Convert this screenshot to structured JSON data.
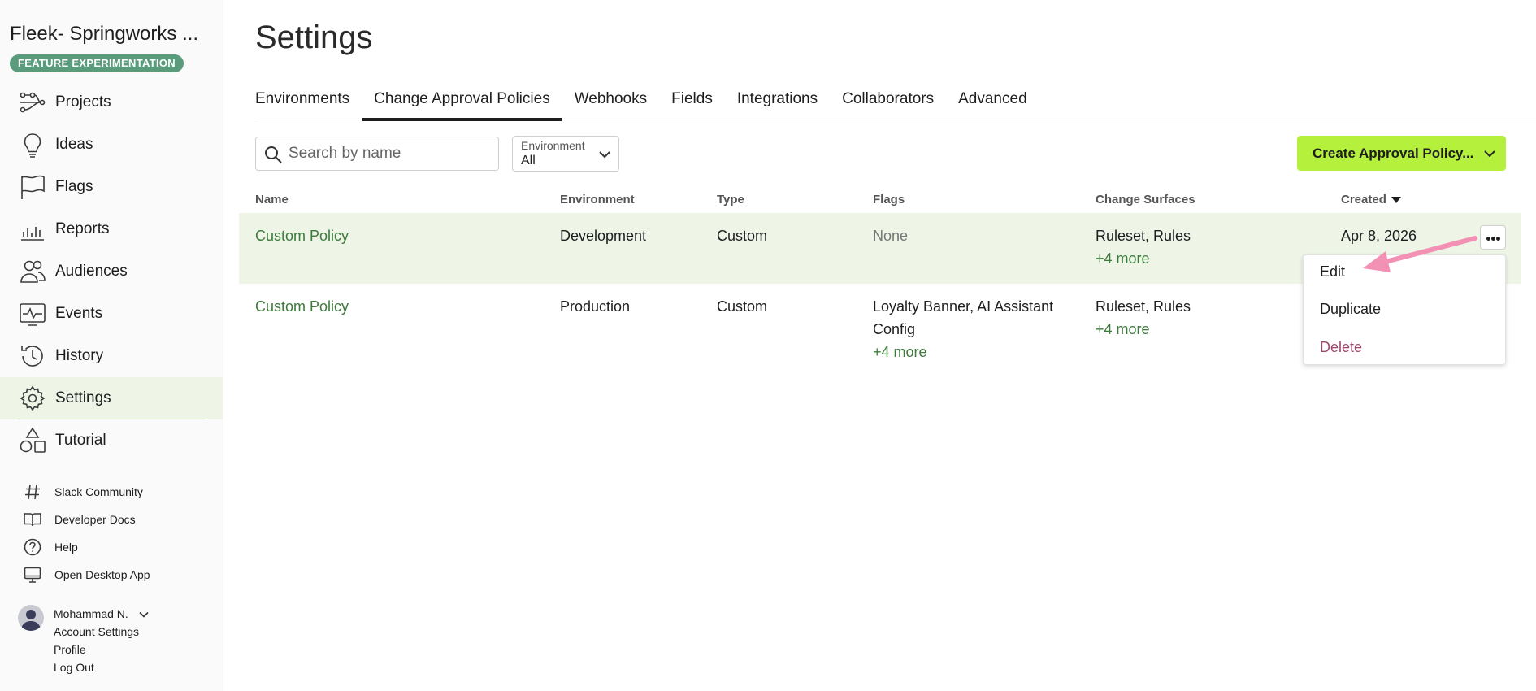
{
  "sidebar": {
    "org_name": "Fleek- Springworks ...",
    "badge": "FEATURE EXPERIMENTATION",
    "nav": [
      {
        "label": "Projects",
        "icon": "projects-icon"
      },
      {
        "label": "Ideas",
        "icon": "lightbulb-icon"
      },
      {
        "label": "Flags",
        "icon": "flag-icon"
      },
      {
        "label": "Reports",
        "icon": "chart-icon"
      },
      {
        "label": "Audiences",
        "icon": "people-icon"
      },
      {
        "label": "Events",
        "icon": "pulse-icon"
      },
      {
        "label": "History",
        "icon": "history-icon"
      },
      {
        "label": "Settings",
        "icon": "gear-icon",
        "active": true
      },
      {
        "label": "Tutorial",
        "icon": "shapes-icon"
      }
    ],
    "links": [
      {
        "label": "Slack Community",
        "icon": "hash-icon"
      },
      {
        "label": "Developer Docs",
        "icon": "book-icon"
      },
      {
        "label": "Help",
        "icon": "help-icon"
      },
      {
        "label": "Open Desktop App",
        "icon": "desktop-icon"
      }
    ],
    "user": {
      "name": "Mohammad N.",
      "account_settings": "Account Settings",
      "profile": "Profile",
      "logout": "Log Out"
    }
  },
  "main": {
    "title": "Settings",
    "tabs": [
      "Environments",
      "Change Approval Policies",
      "Webhooks",
      "Fields",
      "Integrations",
      "Collaborators",
      "Advanced"
    ],
    "active_tab": "Change Approval Policies",
    "search_placeholder": "Search by name",
    "env_filter": {
      "caption": "Environment",
      "value": "All"
    },
    "create_button": "Create Approval Policy...",
    "columns": [
      "Name",
      "Environment",
      "Type",
      "Flags",
      "Change Surfaces",
      "Created"
    ],
    "rows": [
      {
        "name": "Custom Policy",
        "environment": "Development",
        "type": "Custom",
        "flags_line1": "None",
        "flags_line2": "",
        "flags_more": "",
        "surfaces": "Ruleset, Rules",
        "surfaces_more": "+4 more",
        "created": "Apr 8, 2026"
      },
      {
        "name": "Custom Policy",
        "environment": "Production",
        "type": "Custom",
        "flags_line1": "Loyalty Banner, AI Assistant",
        "flags_line2": "Config",
        "flags_more": "+4 more",
        "surfaces": "Ruleset, Rules",
        "surfaces_more": "+4 more",
        "created": ""
      }
    ],
    "row_menu": [
      "Edit",
      "Duplicate",
      "Delete"
    ]
  },
  "colors": {
    "accent": "#b5f03c",
    "badge": "#5a9b7c",
    "link": "#3c7a3c",
    "row_highlight": "#eef5e7",
    "danger": "#9b4a6e",
    "annotation_arrow": "#f291b4"
  }
}
